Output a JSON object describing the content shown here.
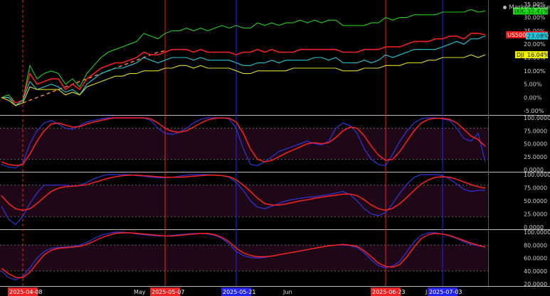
{
  "status": {
    "text": "Market Closed"
  },
  "chart_data": [
    {
      "type": "line",
      "panel": "price-comparison",
      "x_dates": [
        "2025-04-03",
        "2025-04-04",
        "2025-04-07",
        "2025-04-08",
        "2025-04-09",
        "2025-04-10",
        "2025-04-11",
        "2025-04-14",
        "2025-04-15",
        "2025-04-16",
        "2025-04-17",
        "2025-04-21",
        "2025-04-22",
        "2025-04-23",
        "2025-04-24",
        "2025-04-25",
        "2025-04-28",
        "2025-04-29",
        "2025-04-30",
        "2025-05-01",
        "2025-05-02",
        "2025-05-05",
        "2025-05-06",
        "2025-05-07",
        "2025-05-08",
        "2025-05-09",
        "2025-05-12",
        "2025-05-13",
        "2025-05-14",
        "2025-05-15",
        "2025-05-16",
        "2025-05-19",
        "2025-05-20",
        "2025-05-21",
        "2025-05-22",
        "2025-05-23",
        "2025-05-27",
        "2025-05-28",
        "2025-05-29",
        "2025-05-30",
        "2025-06-02",
        "2025-06-03",
        "2025-06-04",
        "2025-06-05",
        "2025-06-06",
        "2025-06-09",
        "2025-06-10",
        "2025-06-11",
        "2025-06-12",
        "2025-06-13",
        "2025-06-16",
        "2025-06-17",
        "2025-06-18",
        "2025-06-20",
        "2025-06-23",
        "2025-06-24",
        "2025-06-25",
        "2025-06-26",
        "2025-06-27",
        "2025-06-30",
        "2025-07-01",
        "2025-07-02",
        "2025-07-03",
        "2025-07-07",
        "2025-07-08",
        "2025-07-09",
        "2025-07-10",
        "2025-07-11",
        "2025-07-14"
      ],
      "y_ticks": [
        35,
        30,
        25,
        20,
        15,
        10,
        5,
        0,
        -5
      ],
      "y_tick_labels": [
        "35.00%",
        "30.00%",
        "25.00%",
        "20.00%",
        "15.00%",
        "10.00%",
        "5.00%",
        "0.00%",
        "-5.00%"
      ],
      "ylim": [
        -6,
        36
      ],
      "series": [
        {
          "name": "IXIC",
          "label": "32.41%",
          "color": "#22cc22",
          "label_bg": "#11dd11",
          "label_fg": "#003300",
          "values": [
            0,
            1,
            -2,
            -1,
            12,
            7,
            9,
            10,
            9,
            5,
            7,
            4,
            9,
            12,
            15,
            17,
            18,
            19,
            20,
            21,
            24,
            23,
            22,
            24,
            25,
            25,
            26,
            25,
            26,
            25,
            26,
            27,
            26,
            27,
            26,
            26,
            28,
            27,
            28,
            27,
            28,
            28,
            29,
            28,
            29,
            28,
            29,
            29,
            27,
            27,
            27,
            27,
            28,
            28,
            30,
            29,
            30,
            30,
            31,
            31,
            31,
            31,
            32,
            32,
            32,
            32,
            33,
            32,
            32.41
          ]
        },
        {
          "name": "US500",
          "label": "23.54%",
          "color": "#ee2222",
          "label_bg": "#ee1111",
          "label_fg": "#ffffff",
          "values": [
            0,
            0,
            -2,
            -1,
            9,
            5,
            6,
            7,
            7,
            3,
            5,
            3,
            7,
            9,
            11,
            12,
            13,
            13,
            14,
            15,
            17,
            16,
            16,
            17,
            18,
            18,
            18,
            17,
            18,
            17,
            17,
            17,
            17,
            16,
            17,
            17,
            18,
            17,
            18,
            17,
            17,
            17,
            18,
            18,
            18,
            18,
            18,
            18,
            17,
            17,
            17,
            18,
            18,
            18,
            19,
            19,
            19,
            20,
            21,
            21,
            21,
            22,
            22,
            23,
            23,
            22,
            24,
            24,
            23.54
          ]
        },
        {
          "name": "QQQ",
          "label": "23.08%",
          "color": "#22c8d8",
          "label_bg": "#22ccdd",
          "label_fg": "#002233",
          "values": [
            0,
            0,
            -3,
            -1,
            6,
            3,
            4,
            5,
            4,
            2,
            3,
            1,
            5,
            7,
            9,
            10,
            11,
            11,
            12,
            13,
            15,
            14,
            13,
            14,
            15,
            15,
            15,
            14,
            15,
            14,
            14,
            14,
            14,
            13,
            12,
            12,
            13,
            13,
            14,
            13,
            14,
            14,
            14,
            14,
            15,
            15,
            14,
            15,
            13,
            13,
            13,
            14,
            13,
            14,
            16,
            15,
            16,
            17,
            18,
            18,
            18,
            18,
            19,
            20,
            21,
            20,
            22,
            22,
            23.08
          ]
        },
        {
          "name": "DJI",
          "label": "16.04%",
          "color": "#dddd22",
          "label_bg": "#eeee00",
          "label_fg": "#222200",
          "values": [
            0,
            -1,
            -3,
            -2,
            4,
            3,
            3,
            3,
            3,
            1,
            2,
            1,
            4,
            5,
            6,
            7,
            8,
            8,
            9,
            9,
            10,
            10,
            10,
            11,
            11,
            12,
            12,
            11,
            12,
            11,
            11,
            11,
            11,
            10,
            9,
            9,
            10,
            10,
            10,
            10,
            10,
            11,
            11,
            11,
            11,
            11,
            11,
            11,
            10,
            10,
            10,
            11,
            11,
            11,
            12,
            12,
            12,
            13,
            13,
            13,
            14,
            14,
            15,
            15,
            15,
            15,
            16,
            15,
            16.04
          ]
        }
      ],
      "projection": {
        "color": "#ff8833",
        "values": [
          -2,
          -1,
          0,
          1,
          2,
          3,
          4,
          5,
          6,
          7,
          8,
          9,
          10,
          11,
          12,
          13,
          14,
          15,
          16,
          17,
          17.5
        ]
      },
      "vlines": [
        {
          "date": "2025-04-08",
          "color": "#ee2222",
          "style": "dashed"
        },
        {
          "date": "2025-05-07",
          "color": "#ee2222",
          "style": "solid"
        },
        {
          "date": "2025-05-21",
          "color": "#2222ee",
          "style": "solid"
        },
        {
          "date": "2025-06-23",
          "color": "#ee2222",
          "style": "solid"
        },
        {
          "date": "2025-07-03",
          "color": "#2222ee",
          "style": "solid"
        }
      ]
    },
    {
      "type": "line",
      "panel": "oscillator-1",
      "ylim": [
        0,
        100
      ],
      "band": [
        20,
        80
      ],
      "y_ticks": [
        100,
        75,
        50,
        25,
        0
      ],
      "y_tick_labels": [
        "100.0000",
        "75.0000",
        "50.0000",
        "25.0000",
        "0.0000"
      ],
      "series": [
        {
          "name": "",
          "color": "#3333dd",
          "values": [
            10,
            5,
            3,
            12,
            50,
            75,
            90,
            95,
            88,
            80,
            78,
            85,
            92,
            95,
            98,
            100,
            100,
            100,
            100,
            100,
            100,
            95,
            80,
            70,
            68,
            72,
            80,
            90,
            97,
            100,
            100,
            100,
            98,
            80,
            40,
            10,
            8,
            15,
            25,
            35,
            40,
            45,
            50,
            55,
            50,
            48,
            55,
            80,
            90,
            85,
            70,
            40,
            20,
            10,
            8,
            30,
            55,
            75,
            90,
            98,
            100,
            100,
            98,
            95,
            80,
            60,
            55,
            70,
            15
          ]
        },
        {
          "name": "",
          "color": "#ee2222",
          "values": [
            15,
            10,
            8,
            10,
            30,
            55,
            75,
            88,
            90,
            86,
            82,
            83,
            88,
            92,
            95,
            98,
            100,
            100,
            100,
            100,
            100,
            98,
            90,
            80,
            74,
            72,
            75,
            82,
            90,
            96,
            99,
            100,
            99,
            92,
            70,
            40,
            20,
            15,
            18,
            25,
            32,
            38,
            44,
            50,
            52,
            50,
            52,
            62,
            75,
            82,
            80,
            65,
            45,
            28,
            18,
            20,
            35,
            55,
            75,
            90,
            97,
            99,
            99,
            97,
            90,
            78,
            65,
            58,
            45
          ]
        }
      ]
    },
    {
      "type": "line",
      "panel": "oscillator-2",
      "ylim": [
        0,
        100
      ],
      "band": [
        20,
        80
      ],
      "y_ticks": [
        100,
        75,
        50,
        25,
        0
      ],
      "y_tick_labels": [
        "100.0000",
        "75.0000",
        "50.0000",
        "25.0000",
        "0.0000"
      ],
      "series": [
        {
          "name": "",
          "color": "#3333dd",
          "values": [
            40,
            15,
            5,
            20,
            45,
            65,
            80,
            80,
            80,
            80,
            78,
            80,
            85,
            92,
            97,
            100,
            100,
            100,
            100,
            98,
            97,
            95,
            94,
            94,
            95,
            97,
            99,
            100,
            100,
            100,
            99,
            98,
            95,
            85,
            70,
            50,
            38,
            35,
            40,
            45,
            50,
            53,
            55,
            57,
            58,
            60,
            62,
            65,
            68,
            62,
            50,
            35,
            25,
            22,
            28,
            45,
            65,
            82,
            95,
            100,
            100,
            100,
            98,
            92,
            82,
            72,
            68,
            70,
            70
          ]
        },
        {
          "name": "",
          "color": "#ee2222",
          "values": [
            60,
            45,
            35,
            32,
            35,
            45,
            57,
            68,
            74,
            77,
            78,
            79,
            81,
            85,
            89,
            93,
            96,
            98,
            99,
            99,
            98,
            97,
            96,
            95,
            95,
            95,
            96,
            97,
            98,
            99,
            99,
            98,
            96,
            90,
            80,
            68,
            55,
            45,
            42,
            42,
            44,
            47,
            50,
            52,
            55,
            57,
            59,
            61,
            63,
            63,
            60,
            52,
            42,
            35,
            32,
            36,
            45,
            57,
            70,
            82,
            90,
            95,
            96,
            95,
            91,
            86,
            81,
            77,
            74
          ]
        }
      ]
    },
    {
      "type": "line",
      "panel": "oscillator-3",
      "ylim": [
        20,
        100
      ],
      "band": [
        40,
        80
      ],
      "y_ticks": [
        100,
        80,
        60,
        40,
        20
      ],
      "y_tick_labels": [
        "100.0000",
        "80.0000",
        "60.0000",
        "40.0000",
        "20.0000"
      ],
      "series": [
        {
          "name": "",
          "color": "#3333dd",
          "values": [
            40,
            30,
            26,
            32,
            45,
            60,
            70,
            75,
            76,
            77,
            78,
            80,
            84,
            90,
            95,
            98,
            100,
            100,
            99,
            97,
            96,
            95,
            94,
            94,
            95,
            96,
            97,
            98,
            98,
            97,
            95,
            90,
            82,
            70,
            64,
            61,
            60,
            61,
            63,
            65,
            67,
            69,
            71,
            73,
            75,
            77,
            79,
            80,
            80,
            79,
            76,
            68,
            57,
            48,
            45,
            48,
            55,
            70,
            85,
            95,
            99,
            99,
            97,
            94,
            90,
            85,
            81,
            79,
            77
          ]
        },
        {
          "name": "",
          "color": "#ee2222",
          "values": [
            44,
            36,
            30,
            30,
            38,
            52,
            65,
            72,
            75,
            76,
            77,
            78,
            81,
            86,
            91,
            95,
            98,
            99,
            99,
            98,
            97,
            96,
            95,
            94,
            94,
            95,
            96,
            97,
            98,
            98,
            96,
            92,
            85,
            75,
            68,
            64,
            62,
            62,
            63,
            65,
            67,
            69,
            71,
            73,
            75,
            77,
            79,
            80,
            81,
            80,
            78,
            71,
            62,
            52,
            47,
            46,
            50,
            62,
            77,
            90,
            96,
            98,
            97,
            95,
            91,
            87,
            83,
            80,
            77
          ]
        }
      ]
    }
  ],
  "x_axis": {
    "month_labels": [
      {
        "date": "2025-05-01",
        "text": "May"
      },
      {
        "date": "2025-06-02",
        "text": "Jun"
      },
      {
        "date": "2025-07-01",
        "text": "Ju"
      }
    ],
    "date_tags": [
      {
        "date": "2025-04-08",
        "text": "2025-04-08",
        "bg": "#ee2222"
      },
      {
        "date": "2025-05-07",
        "text": "2025-05-07",
        "bg": "#ee2222"
      },
      {
        "date": "2025-05-21",
        "text": "2025-05-21",
        "bg": "#2222ee"
      },
      {
        "date": "2025-06-23",
        "text": "2025-06-23",
        "bg": "#ee2222"
      },
      {
        "date": "2025-07-03",
        "text": "2025-07-03",
        "bg": "#2222ee"
      }
    ]
  }
}
